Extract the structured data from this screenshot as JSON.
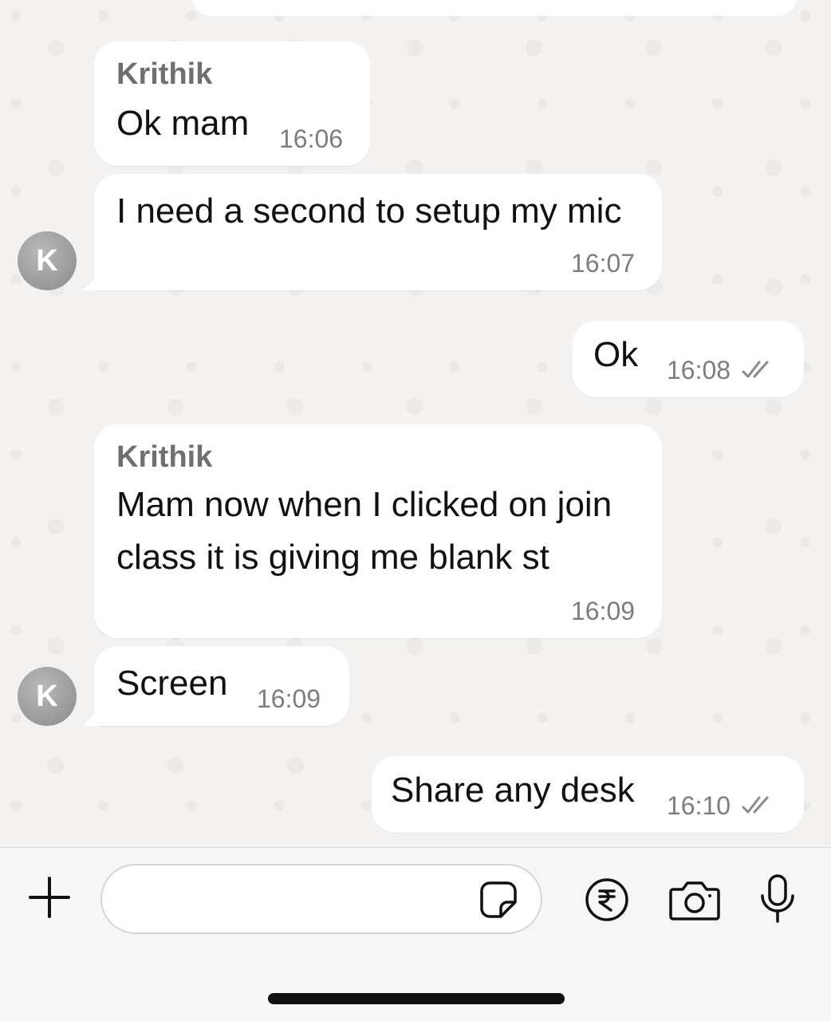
{
  "messages": [
    {
      "sender": "Krithik",
      "text": "Ok mam",
      "time": "16:06",
      "direction": "incoming"
    },
    {
      "text": "I need a second to setup my mic",
      "time": "16:07",
      "direction": "incoming"
    },
    {
      "text": "Ok",
      "time": "16:08",
      "direction": "outgoing",
      "status": "read-ticks"
    },
    {
      "sender": "Krithik",
      "text_lines": [
        "Mam now when I clicked on join",
        "class it is giving me blank st"
      ],
      "time": "16:09",
      "direction": "incoming"
    },
    {
      "text": "Screen",
      "time": "16:09",
      "direction": "incoming"
    },
    {
      "text": "Share any desk",
      "time": "16:10",
      "direction": "outgoing",
      "status": "read-ticks"
    }
  ],
  "avatars": [
    {
      "initial": "K"
    },
    {
      "initial": "K"
    }
  ],
  "composer": {
    "placeholder": "",
    "icons": [
      "plus-icon",
      "sticker-icon",
      "rupee-payment-icon",
      "camera-icon",
      "microphone-icon"
    ]
  },
  "colors": {
    "bubble": "#ffffff",
    "background": "#f3f2f0",
    "sender_name": "#6f6f6f",
    "timestamp": "#7d7d7d",
    "avatar": "#9a9a9a"
  }
}
